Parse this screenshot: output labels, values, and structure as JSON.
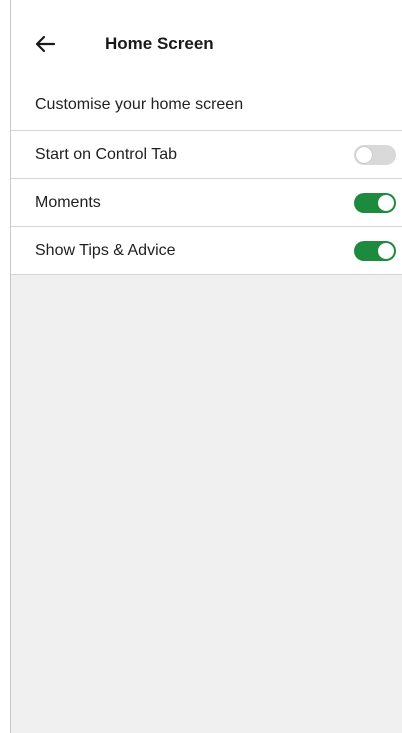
{
  "header": {
    "title": "Home Screen",
    "back_icon": "arrow-left-icon"
  },
  "section": {
    "heading": "Customise your home screen"
  },
  "settings": [
    {
      "label": "Start on Control Tab",
      "enabled": false
    },
    {
      "label": "Moments",
      "enabled": true
    },
    {
      "label": "Show Tips & Advice",
      "enabled": true
    }
  ],
  "colors": {
    "toggle_on": "#1e8a3e",
    "toggle_off": "#d9d9d9",
    "background": "#f0f0f0"
  }
}
